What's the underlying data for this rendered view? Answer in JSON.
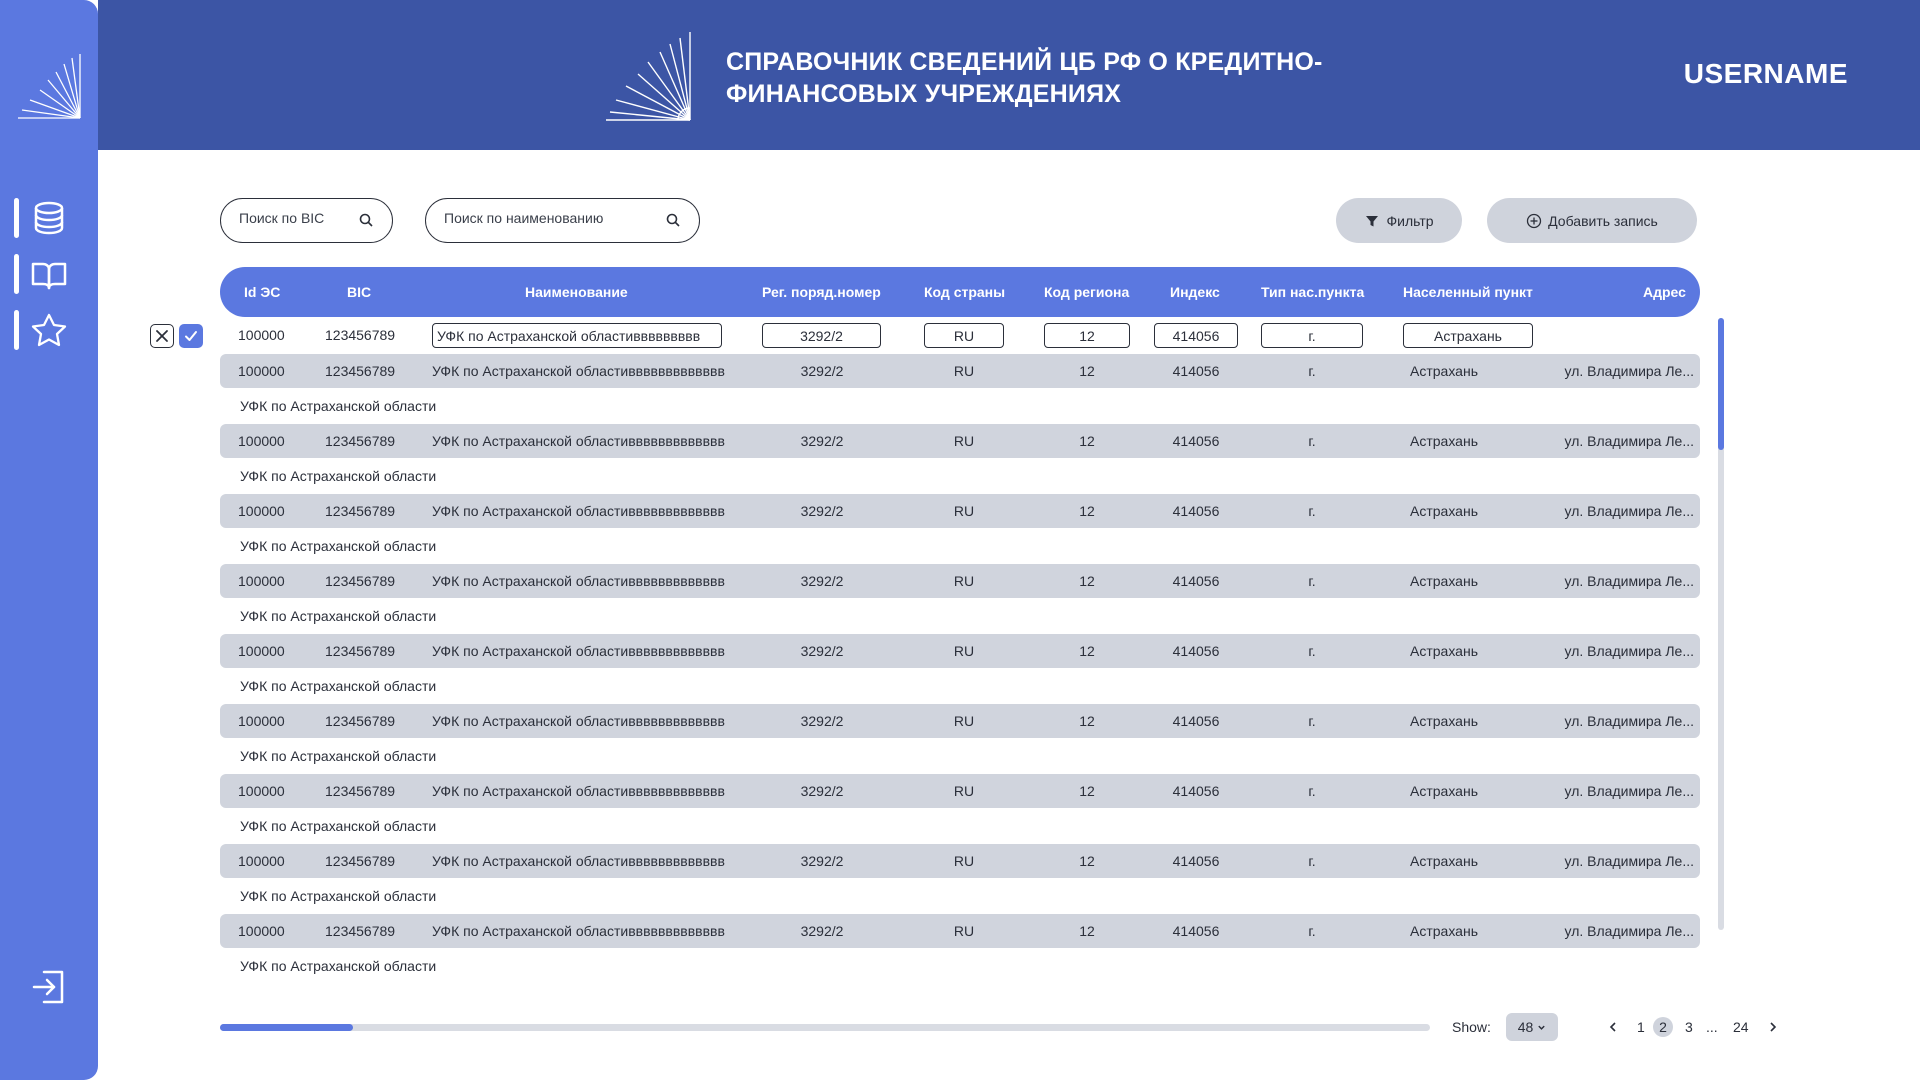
{
  "header": {
    "title": "СПРАВОЧНИК СВЕДЕНИЙ ЦБ РФ О КРЕДИТНО-ФИНАНСОВЫХ УЧРЕЖДЕНИЯХ",
    "username": "USERNAME"
  },
  "sidebar": {
    "items": [
      {
        "icon": "database-icon"
      },
      {
        "icon": "book-icon"
      },
      {
        "icon": "star-icon"
      }
    ],
    "exit_icon": "logout-icon"
  },
  "toolbar": {
    "search_bic_placeholder": "Поиск по BIC",
    "search_name_placeholder": "Поиск по наименованию",
    "filter_label": "Фильтр",
    "add_label": "Добавить запись"
  },
  "table": {
    "columns": [
      "Id ЭС",
      "BIC",
      "Наименование",
      "Рег. поряд.номер",
      "Код страны",
      "Код региона",
      "Индекс",
      "Тип нас.пункта",
      "Населенный пункт",
      "Адрес"
    ],
    "edit_row": {
      "id": "100000",
      "bic": "123456789",
      "name": "УФК по Астраханской областиввввввввв",
      "reg": "3292/2",
      "country": "RU",
      "region": "12",
      "index": "414056",
      "type": "г.",
      "city": "Астрахань"
    },
    "rows": [
      {
        "id": "100000",
        "bic": "123456789",
        "name": "УФК по Астраханской областиввввввввввввв",
        "reg": "3292/2",
        "country": "RU",
        "region": "12",
        "index": "414056",
        "type": "г.",
        "city": "Астрахань",
        "address": "ул. Владимира Ле...",
        "sub": "УФК по Астраханской области"
      },
      {
        "id": "100000",
        "bic": "123456789",
        "name": "УФК по Астраханской областиввввввввввввв",
        "reg": "3292/2",
        "country": "RU",
        "region": "12",
        "index": "414056",
        "type": "г.",
        "city": "Астрахань",
        "address": "ул. Владимира Ле...",
        "sub": "УФК по Астраханской области"
      },
      {
        "id": "100000",
        "bic": "123456789",
        "name": "УФК по Астраханской областиввввввввввввв",
        "reg": "3292/2",
        "country": "RU",
        "region": "12",
        "index": "414056",
        "type": "г.",
        "city": "Астрахань",
        "address": "ул. Владимира Ле...",
        "sub": "УФК по Астраханской области"
      },
      {
        "id": "100000",
        "bic": "123456789",
        "name": "УФК по Астраханской областиввввввввввввв",
        "reg": "3292/2",
        "country": "RU",
        "region": "12",
        "index": "414056",
        "type": "г.",
        "city": "Астрахань",
        "address": "ул. Владимира Ле...",
        "sub": "УФК по Астраханской области"
      },
      {
        "id": "100000",
        "bic": "123456789",
        "name": "УФК по Астраханской областиввввввввввввв",
        "reg": "3292/2",
        "country": "RU",
        "region": "12",
        "index": "414056",
        "type": "г.",
        "city": "Астрахань",
        "address": "ул. Владимира Ле...",
        "sub": "УФК по Астраханской области"
      },
      {
        "id": "100000",
        "bic": "123456789",
        "name": "УФК по Астраханской областиввввввввввввв",
        "reg": "3292/2",
        "country": "RU",
        "region": "12",
        "index": "414056",
        "type": "г.",
        "city": "Астрахань",
        "address": "ул. Владимира Ле...",
        "sub": "УФК по Астраханской области"
      },
      {
        "id": "100000",
        "bic": "123456789",
        "name": "УФК по Астраханской областиввввввввввввв",
        "reg": "3292/2",
        "country": "RU",
        "region": "12",
        "index": "414056",
        "type": "г.",
        "city": "Астрахань",
        "address": "ул. Владимира Ле...",
        "sub": "УФК по Астраханской области"
      },
      {
        "id": "100000",
        "bic": "123456789",
        "name": "УФК по Астраханской областиввввввввввввв",
        "reg": "3292/2",
        "country": "RU",
        "region": "12",
        "index": "414056",
        "type": "г.",
        "city": "Астрахань",
        "address": "ул. Владимира Ле...",
        "sub": "УФК по Астраханской области"
      },
      {
        "id": "100000",
        "bic": "123456789",
        "name": "УФК по Астраханской областиввввввввввввв",
        "reg": "3292/2",
        "country": "RU",
        "region": "12",
        "index": "414056",
        "type": "г.",
        "city": "Астрахань",
        "address": "ул. Владимира Ле...",
        "sub": "УФК по Астраханской области"
      }
    ]
  },
  "footer": {
    "show_label": "Show:",
    "show_value": "48",
    "pages": [
      "1",
      "2",
      "3",
      "...",
      "24"
    ],
    "current_page": "2",
    "horizontal_scroll_fraction": 0.11
  },
  "colors": {
    "accent": "#5b78e0",
    "header": "#3c55a5",
    "row": "#d0d4dd",
    "button": "#cfd3dc"
  }
}
